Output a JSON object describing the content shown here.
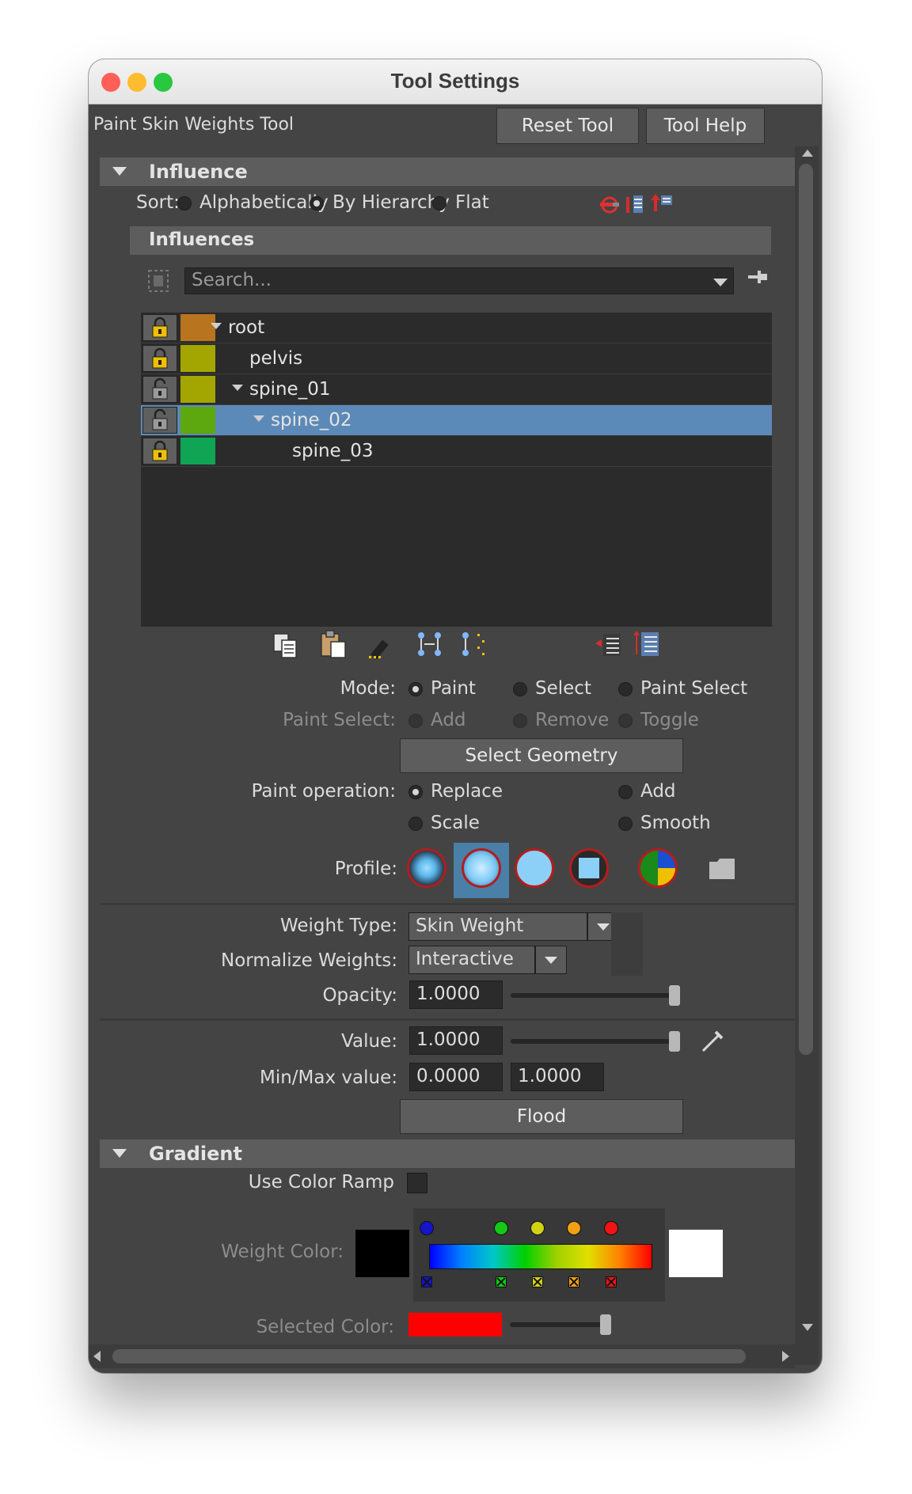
{
  "window": {
    "title": "Tool Settings",
    "traffic_lights": {
      "close": "#ff5f57",
      "minimize": "#febc2e",
      "zoom": "#28c840"
    }
  },
  "header": {
    "tool_name": "Paint Skin Weights Tool",
    "reset_button": "Reset Tool",
    "help_button": "Tool Help"
  },
  "influence": {
    "section_title": "Influence",
    "sort_label": "Sort:",
    "sort_options": [
      "Alphabetically",
      "By Hierarchy",
      "Flat"
    ],
    "sort_selected": "By Hierarchy",
    "influences_title": "Influences",
    "search_placeholder": "Search...",
    "tree": [
      {
        "name": "root",
        "color": "#b8741e",
        "locked": true,
        "expanded": true,
        "depth": 0,
        "selected": false
      },
      {
        "name": "pelvis",
        "color": "#a3a600",
        "locked": true,
        "expanded": false,
        "depth": 1,
        "selected": false
      },
      {
        "name": "spine_01",
        "color": "#a3a600",
        "locked": false,
        "expanded": true,
        "depth": 1,
        "selected": false
      },
      {
        "name": "spine_02",
        "color": "#5ca80e",
        "locked": false,
        "expanded": true,
        "depth": 2,
        "selected": true
      },
      {
        "name": "spine_03",
        "color": "#0fa554",
        "locked": true,
        "expanded": false,
        "depth": 3,
        "selected": false
      }
    ]
  },
  "paint": {
    "mode_label": "Mode:",
    "mode_options": [
      "Paint",
      "Select",
      "Paint Select"
    ],
    "mode_selected": "Paint",
    "paint_select_label": "Paint Select:",
    "paint_select_options": [
      "Add",
      "Remove",
      "Toggle"
    ],
    "select_geometry_button": "Select Geometry",
    "operation_label": "Paint operation:",
    "operation_options": [
      "Replace",
      "Add",
      "Scale",
      "Smooth"
    ],
    "operation_selected": "Replace",
    "profile_label": "Profile:",
    "profile_selected_index": 1
  },
  "weights": {
    "weight_type_label": "Weight Type:",
    "weight_type_value": "Skin Weight",
    "normalize_label": "Normalize Weights:",
    "normalize_value": "Interactive",
    "opacity_label": "Opacity:",
    "opacity_value": "1.0000",
    "opacity_fraction": 1.0,
    "value_label": "Value:",
    "value_value": "1.0000",
    "value_fraction": 1.0,
    "minmax_label": "Min/Max value:",
    "min_value": "0.0000",
    "max_value": "1.0000",
    "flood_button": "Flood"
  },
  "gradient": {
    "section_title": "Gradient",
    "use_color_ramp_label": "Use Color Ramp",
    "weight_color_label": "Weight Color:",
    "weight_color_low": "#000000",
    "weight_color_high": "#ffffff",
    "ramp_markers": [
      "#1414c8",
      "#14c814",
      "#d2d214",
      "#f0a014",
      "#f01414"
    ],
    "selected_color_label": "Selected Color:",
    "selected_color": "#ff0000",
    "selected_color_fraction": 1.0
  }
}
